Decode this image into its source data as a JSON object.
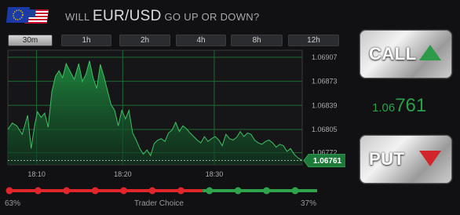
{
  "header": {
    "question_prefix": "WILL",
    "pair": "EUR/USD",
    "question_suffix": "GO UP OR DOWN?"
  },
  "icons": {
    "flag": "eu-us-flag-icon",
    "call": "arrow-up-icon",
    "put": "arrow-down-icon"
  },
  "timeframes": [
    "30m",
    "1h",
    "2h",
    "4h",
    "8h",
    "12h"
  ],
  "active_timeframe": "30m",
  "chart_data": {
    "type": "area",
    "y_ticks": [
      "1.06907",
      "1.06873",
      "1.06839",
      "1.06805",
      "1.06772"
    ],
    "ylim": [
      1.06755,
      1.06917
    ],
    "x_ticks": [
      "18:10",
      "18:20",
      "18:30"
    ],
    "x_tick_minutes": [
      3.2,
      12.8,
      23.0
    ],
    "xlim": [
      0,
      32.8
    ],
    "current_price_label": "1.06761",
    "current_price": 1.06761,
    "grid": true,
    "x": [
      0,
      0.5,
      1,
      1.6,
      2.2,
      2.6,
      3,
      3.3,
      3.7,
      4.1,
      4.5,
      4.9,
      5.3,
      5.7,
      6.1,
      6.5,
      6.9,
      7.4,
      7.9,
      8.3,
      8.7,
      9.1,
      9.5,
      9.9,
      10.3,
      10.7,
      11.1,
      11.5,
      11.9,
      12.3,
      12.7,
      13.1,
      13.5,
      13.9,
      14.3,
      14.7,
      15.1,
      15.5,
      15.9,
      16.3,
      16.7,
      17.1,
      17.5,
      17.9,
      18.3,
      18.7,
      19.1,
      19.5,
      19.9,
      20.3,
      20.7,
      21.1,
      21.5,
      21.9,
      22.3,
      22.7,
      23.1,
      23.5,
      23.9,
      24.3,
      24.7,
      25.1,
      25.5,
      25.9,
      26.3,
      26.7,
      27.1,
      27.5,
      27.9,
      28.3,
      28.7,
      29.1,
      29.5,
      29.9,
      30.3,
      30.7,
      31.1,
      31.5,
      31.9,
      32.3,
      32.8
    ],
    "y": [
      1.06805,
      1.06814,
      1.0681,
      1.06798,
      1.06825,
      1.06778,
      1.06812,
      1.0683,
      1.06822,
      1.06828,
      1.06808,
      1.06858,
      1.0688,
      1.06888,
      1.06878,
      1.06898,
      1.06888,
      1.06876,
      1.06898,
      1.06873,
      1.06883,
      1.06902,
      1.06878,
      1.06863,
      1.06897,
      1.0688,
      1.0686,
      1.0684,
      1.06832,
      1.0681,
      1.06832,
      1.0682,
      1.06832,
      1.068,
      1.0679,
      1.06778,
      1.0677,
      1.06776,
      1.06768,
      1.06785,
      1.0679,
      1.06792,
      1.06788,
      1.068,
      1.06804,
      1.06815,
      1.06802,
      1.0681,
      1.06806,
      1.068,
      1.06795,
      1.0679,
      1.06786,
      1.06795,
      1.06788,
      1.06792,
      1.06795,
      1.0679,
      1.06782,
      1.06798,
      1.06792,
      1.0679,
      1.06794,
      1.06802,
      1.06795,
      1.068,
      1.06798,
      1.0679,
      1.06786,
      1.06784,
      1.06788,
      1.0679,
      1.06786,
      1.0678,
      1.06784,
      1.06782,
      1.06774,
      1.06778,
      1.0677,
      1.06765,
      1.06761
    ]
  },
  "current_price": {
    "prefix": "1.06",
    "suffix": "761"
  },
  "call_label": "CALL",
  "put_label": "PUT",
  "trader_choice": {
    "label": "Trader Choice",
    "call_pct": "63%",
    "put_pct": "37%",
    "call_fraction": 0.63
  },
  "colors": {
    "green": "#2fa34b",
    "red": "#e0262b",
    "accent": "#1f7a38"
  }
}
